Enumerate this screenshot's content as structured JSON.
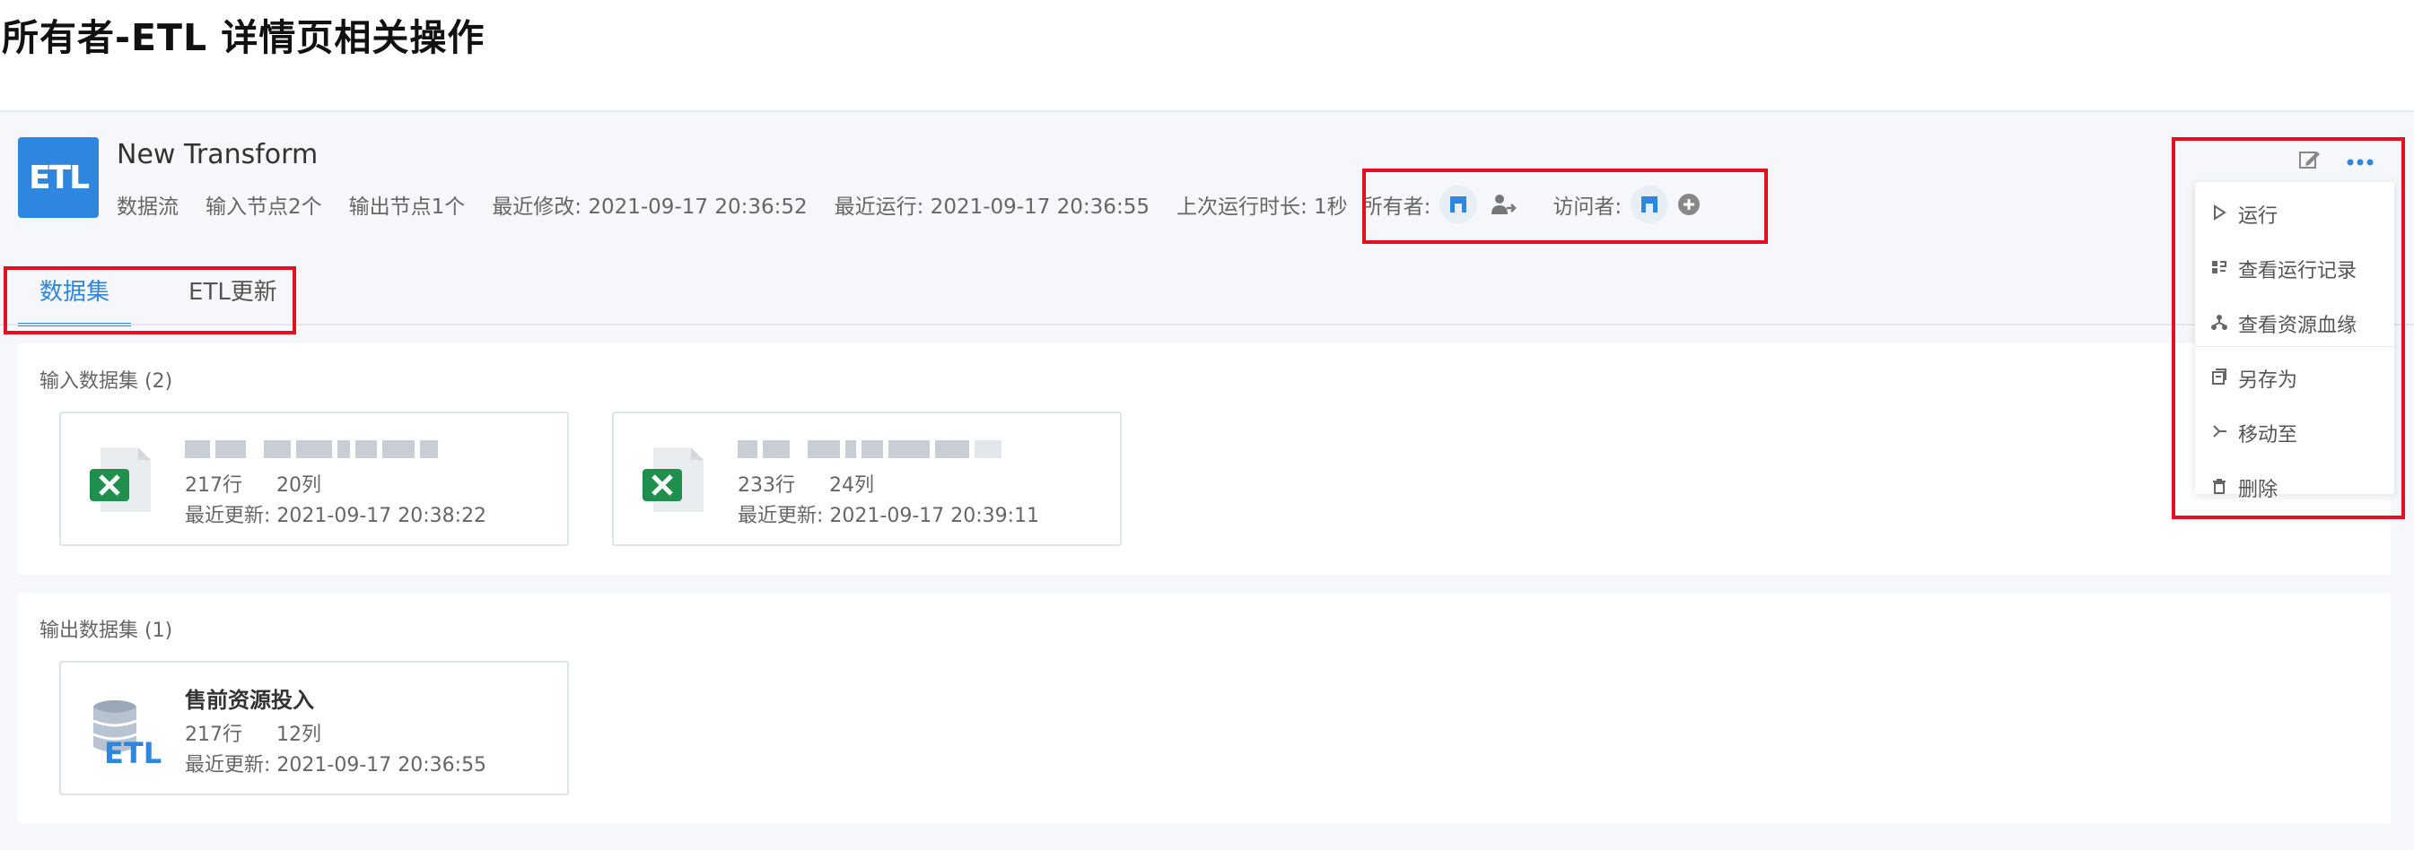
{
  "doc_title": "所有者-ETL 详情页相关操作",
  "header": {
    "logo_text": "ETL",
    "name": "New Transform",
    "meta": {
      "type": "数据流",
      "inputs": "输入节点2个",
      "outputs": "输出节点1个",
      "modified": "最近修改: 2021-09-17 20:36:52",
      "last_run": "最近运行: 2021-09-17 20:36:55",
      "duration": "上次运行时长: 1秒",
      "owner_label": "所有者:",
      "visitor_label": "访问者:"
    },
    "icons": [
      "edit-icon",
      "more-icon"
    ]
  },
  "tabs": [
    {
      "label": "数据集",
      "active": true
    },
    {
      "label": "ETL更新",
      "active": false
    }
  ],
  "input_section": {
    "title": "输入数据集 (2)",
    "cards": [
      {
        "rows": "217行",
        "cols": "20列",
        "updated": "最近更新: 2021-09-17 20:38:22",
        "icon": "excel-icon"
      },
      {
        "rows": "233行",
        "cols": "24列",
        "updated": "最近更新: 2021-09-17 20:39:11",
        "icon": "excel-icon"
      }
    ]
  },
  "output_section": {
    "title": "输出数据集 (1)",
    "cards": [
      {
        "name": "售前资源投入",
        "rows": "217行",
        "cols": "12列",
        "updated": "最近更新: 2021-09-17 20:36:55",
        "icon": "etl-db-icon"
      }
    ]
  },
  "menu": {
    "items": [
      {
        "label": "运行",
        "icon": "play-icon"
      },
      {
        "label": "查看运行记录",
        "icon": "run-log-icon"
      },
      {
        "label": "查看资源血缘",
        "icon": "lineage-icon"
      },
      {
        "label": "另存为",
        "icon": "save-as-icon"
      },
      {
        "label": "移动至",
        "icon": "move-icon"
      },
      {
        "label": "删除",
        "icon": "trash-icon"
      }
    ]
  },
  "colors": {
    "accent": "#2e86de",
    "highlight": "#e5101e",
    "excel": "#1f8f4e"
  }
}
